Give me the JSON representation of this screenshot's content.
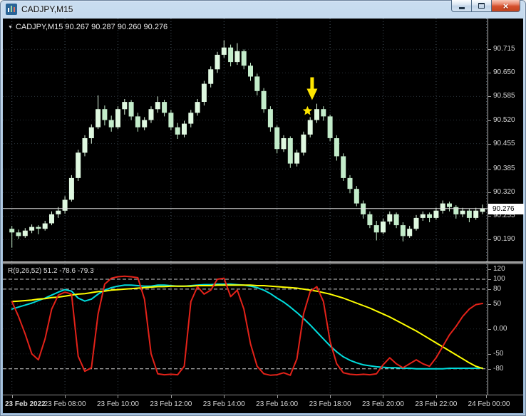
{
  "window": {
    "title": "CADJPY,M15",
    "close_glyph": "×"
  },
  "chart": {
    "ohlc_marker": "▼",
    "ohlc_line": "CADJPY,M15 90.267 90.287 90.260 90.276",
    "price_box": "90.276",
    "indicator_label": "R(9,26,52) 51.2 -78.6 -79.3"
  },
  "chart_data": [
    {
      "type": "candlestick",
      "symbol": "CADJPY",
      "timeframe": "M15",
      "ohlc_display": {
        "open": 90.267,
        "high": 90.287,
        "low": 90.26,
        "close": 90.276
      },
      "current_price": 90.276,
      "ylim": [
        90.13,
        90.8
      ],
      "y_ticks": [
        90.715,
        90.65,
        90.585,
        90.52,
        90.455,
        90.385,
        90.32,
        90.255,
        90.19
      ],
      "x_labels": [
        {
          "i": 0,
          "label": "23 Feb 2022",
          "date": true
        },
        {
          "i": 8,
          "label": "23 Feb 08:00"
        },
        {
          "i": 16,
          "label": "23 Feb 10:00"
        },
        {
          "i": 24,
          "label": "23 Feb 12:00"
        },
        {
          "i": 32,
          "label": "23 Feb 14:00"
        },
        {
          "i": 40,
          "label": "23 Feb 16:00"
        },
        {
          "i": 48,
          "label": "23 Feb 18:00"
        },
        {
          "i": 56,
          "label": "23 Feb 20:00"
        },
        {
          "i": 64,
          "label": "23 Feb 22:00"
        },
        {
          "i": 72,
          "label": "24 Feb 00:00"
        }
      ],
      "bull_color": "#dff8e0",
      "bear_color": "#c3ecca",
      "grid_color": "#46545f",
      "price_line_color": "#dedede",
      "candles_ohlc": [
        [
          90.22,
          90.228,
          90.168,
          90.21
        ],
        [
          90.21,
          90.218,
          90.192,
          90.2
        ],
        [
          90.2,
          90.222,
          90.195,
          90.215
        ],
        [
          90.215,
          90.232,
          90.208,
          90.225
        ],
        [
          90.225,
          90.23,
          90.205,
          90.22
        ],
        [
          90.22,
          90.242,
          90.215,
          90.235
        ],
        [
          90.235,
          90.268,
          90.23,
          90.26
        ],
        [
          90.26,
          90.28,
          90.25,
          90.27
        ],
        [
          90.27,
          90.31,
          90.262,
          90.3
        ],
        [
          90.3,
          90.368,
          90.295,
          90.36
        ],
        [
          90.36,
          90.438,
          90.352,
          90.43
        ],
        [
          90.43,
          90.478,
          90.42,
          90.47
        ],
        [
          90.47,
          90.508,
          90.455,
          90.5
        ],
        [
          90.5,
          90.588,
          90.495,
          90.55
        ],
        [
          90.55,
          90.56,
          90.505,
          90.52
        ],
        [
          90.52,
          90.532,
          90.488,
          90.5
        ],
        [
          90.5,
          90.558,
          90.495,
          90.55
        ],
        [
          90.55,
          90.578,
          90.535,
          90.57
        ],
        [
          90.57,
          90.575,
          90.52,
          90.53
        ],
        [
          90.53,
          90.54,
          90.488,
          90.5
        ],
        [
          90.5,
          90.528,
          90.492,
          90.52
        ],
        [
          90.52,
          90.558,
          90.512,
          90.55
        ],
        [
          90.55,
          90.585,
          90.54,
          90.57
        ],
        [
          90.57,
          90.576,
          90.53,
          90.54
        ],
        [
          90.54,
          90.548,
          90.492,
          90.5
        ],
        [
          90.5,
          90.512,
          90.468,
          90.48
        ],
        [
          90.48,
          90.518,
          90.472,
          90.51
        ],
        [
          90.51,
          90.548,
          90.5,
          90.54
        ],
        [
          90.54,
          90.578,
          90.532,
          90.57
        ],
        [
          90.57,
          90.628,
          90.56,
          90.62
        ],
        [
          90.62,
          90.668,
          90.61,
          90.66
        ],
        [
          90.66,
          90.708,
          90.65,
          90.7
        ],
        [
          90.7,
          90.74,
          90.692,
          90.72
        ],
        [
          90.72,
          90.728,
          90.668,
          90.68
        ],
        [
          90.68,
          90.732,
          90.672,
          90.71
        ],
        [
          90.71,
          90.715,
          90.66,
          90.67
        ],
        [
          90.67,
          90.678,
          90.628,
          90.64
        ],
        [
          90.64,
          90.648,
          90.588,
          90.6
        ],
        [
          90.6,
          90.608,
          90.54,
          90.55
        ],
        [
          90.55,
          90.558,
          90.488,
          90.5
        ],
        [
          90.5,
          90.505,
          90.428,
          90.44
        ],
        [
          90.44,
          90.478,
          90.432,
          90.47
        ],
        [
          90.47,
          90.475,
          90.388,
          90.4
        ],
        [
          90.4,
          90.438,
          90.392,
          90.43
        ],
        [
          90.43,
          90.488,
          90.422,
          90.48
        ],
        [
          90.48,
          90.528,
          90.472,
          90.52
        ],
        [
          90.52,
          90.565,
          90.512,
          90.55
        ],
        [
          90.55,
          90.558,
          90.518,
          90.53
        ],
        [
          90.53,
          90.535,
          90.462,
          90.47
        ],
        [
          90.47,
          90.478,
          90.408,
          90.42
        ],
        [
          90.42,
          90.428,
          90.352,
          90.36
        ],
        [
          90.36,
          90.368,
          90.318,
          90.33
        ],
        [
          90.33,
          90.338,
          90.282,
          90.29
        ],
        [
          90.29,
          90.298,
          90.248,
          90.26
        ],
        [
          90.26,
          90.268,
          90.222,
          90.23
        ],
        [
          90.23,
          90.242,
          90.188,
          90.21
        ],
        [
          90.21,
          90.248,
          90.205,
          90.24
        ],
        [
          90.24,
          90.268,
          90.232,
          90.26
        ],
        [
          90.26,
          90.265,
          90.222,
          90.23
        ],
        [
          90.23,
          90.238,
          90.185,
          90.2
        ],
        [
          90.2,
          90.228,
          90.195,
          90.22
        ],
        [
          90.22,
          90.258,
          90.215,
          90.25
        ],
        [
          90.25,
          90.268,
          90.242,
          90.26
        ],
        [
          90.26,
          90.265,
          90.238,
          90.25
        ],
        [
          90.25,
          90.278,
          90.245,
          90.27
        ],
        [
          90.27,
          90.298,
          90.262,
          90.29
        ],
        [
          90.29,
          90.295,
          90.268,
          90.28
        ],
        [
          90.28,
          90.285,
          90.248,
          90.26
        ],
        [
          90.26,
          90.278,
          90.252,
          90.27
        ],
        [
          90.27,
          90.275,
          90.238,
          90.25
        ],
        [
          90.25,
          90.278,
          90.245,
          90.27
        ],
        [
          90.267,
          90.287,
          90.26,
          90.276
        ]
      ],
      "annotations": [
        {
          "type": "arrow-down",
          "color": "#ffe600",
          "x_index": 45.3,
          "tip_price": 90.575,
          "tail_price": 90.638
        },
        {
          "type": "star",
          "color": "#ffe600",
          "x_index": 44.6,
          "price": 90.545
        }
      ]
    },
    {
      "type": "line",
      "name": "R(9,26,52)",
      "current_values": [
        51.2,
        -78.6,
        -79.3
      ],
      "ylim": [
        -132,
        130
      ],
      "y_ticks": [
        {
          "v": 120,
          "label": "120"
        },
        {
          "v": 100,
          "label": "100"
        },
        {
          "v": 80,
          "label": "80"
        },
        {
          "v": 50,
          "label": "50"
        },
        {
          "v": 0,
          "label": "0.00"
        },
        {
          "v": -50,
          "label": "-50"
        },
        {
          "v": -80,
          "label": "-80"
        }
      ],
      "levels": [
        100,
        80,
        -80
      ],
      "level_color": "#cfcfcf",
      "grid_color": "#3c4750",
      "series": [
        {
          "name": "R9",
          "color": "#e32219",
          "values": [
            55,
            25,
            -10,
            -50,
            -62,
            -20,
            40,
            68,
            74,
            70,
            -55,
            -85,
            -78,
            30,
            90,
            102,
            105,
            106,
            105,
            103,
            60,
            -50,
            -90,
            -92,
            -91,
            -92,
            -75,
            55,
            85,
            70,
            78,
            100,
            102,
            65,
            78,
            40,
            -30,
            -75,
            -90,
            -93,
            -92,
            -88,
            -93,
            -60,
            30,
            75,
            85,
            55,
            -25,
            -70,
            -88,
            -91,
            -92,
            -91,
            -92,
            -90,
            -72,
            -58,
            -70,
            -78,
            -70,
            -62,
            -70,
            -75,
            -58,
            -35,
            -12,
            5,
            25,
            40,
            49,
            51.2
          ]
        },
        {
          "name": "R26",
          "color": "#00dcdc",
          "values": [
            40,
            44,
            48,
            52,
            57,
            62,
            68,
            74,
            79,
            76,
            62,
            56,
            60,
            70,
            78,
            83,
            86,
            88,
            88,
            87,
            86,
            86,
            88,
            88,
            87,
            86,
            86,
            87,
            88,
            89,
            89,
            90,
            90,
            90,
            89,
            88,
            86,
            83,
            78,
            71,
            62,
            54,
            44,
            33,
            21,
            8,
            -6,
            -20,
            -34,
            -46,
            -56,
            -63,
            -68,
            -72,
            -74,
            -76,
            -77,
            -78,
            -78,
            -79,
            -79,
            -80,
            -80,
            -80,
            -80,
            -80,
            -79,
            -79,
            -79,
            -79,
            -79,
            -78.6
          ]
        },
        {
          "name": "R52",
          "color": "#ffff00",
          "values": [
            55,
            56,
            57,
            58,
            60,
            61,
            63,
            64,
            66,
            68,
            70,
            71,
            73,
            75,
            76,
            78,
            79,
            80,
            81,
            82,
            83,
            84,
            85,
            85,
            86,
            86,
            86,
            86,
            87,
            87,
            87,
            88,
            88,
            88,
            88,
            88,
            88,
            87,
            87,
            86,
            85,
            84,
            83,
            82,
            80,
            78,
            76,
            73,
            70,
            66,
            62,
            57,
            52,
            47,
            42,
            36,
            30,
            24,
            17,
            10,
            3,
            -4,
            -12,
            -20,
            -28,
            -36,
            -44,
            -52,
            -60,
            -68,
            -75,
            -79.3
          ]
        }
      ]
    }
  ]
}
